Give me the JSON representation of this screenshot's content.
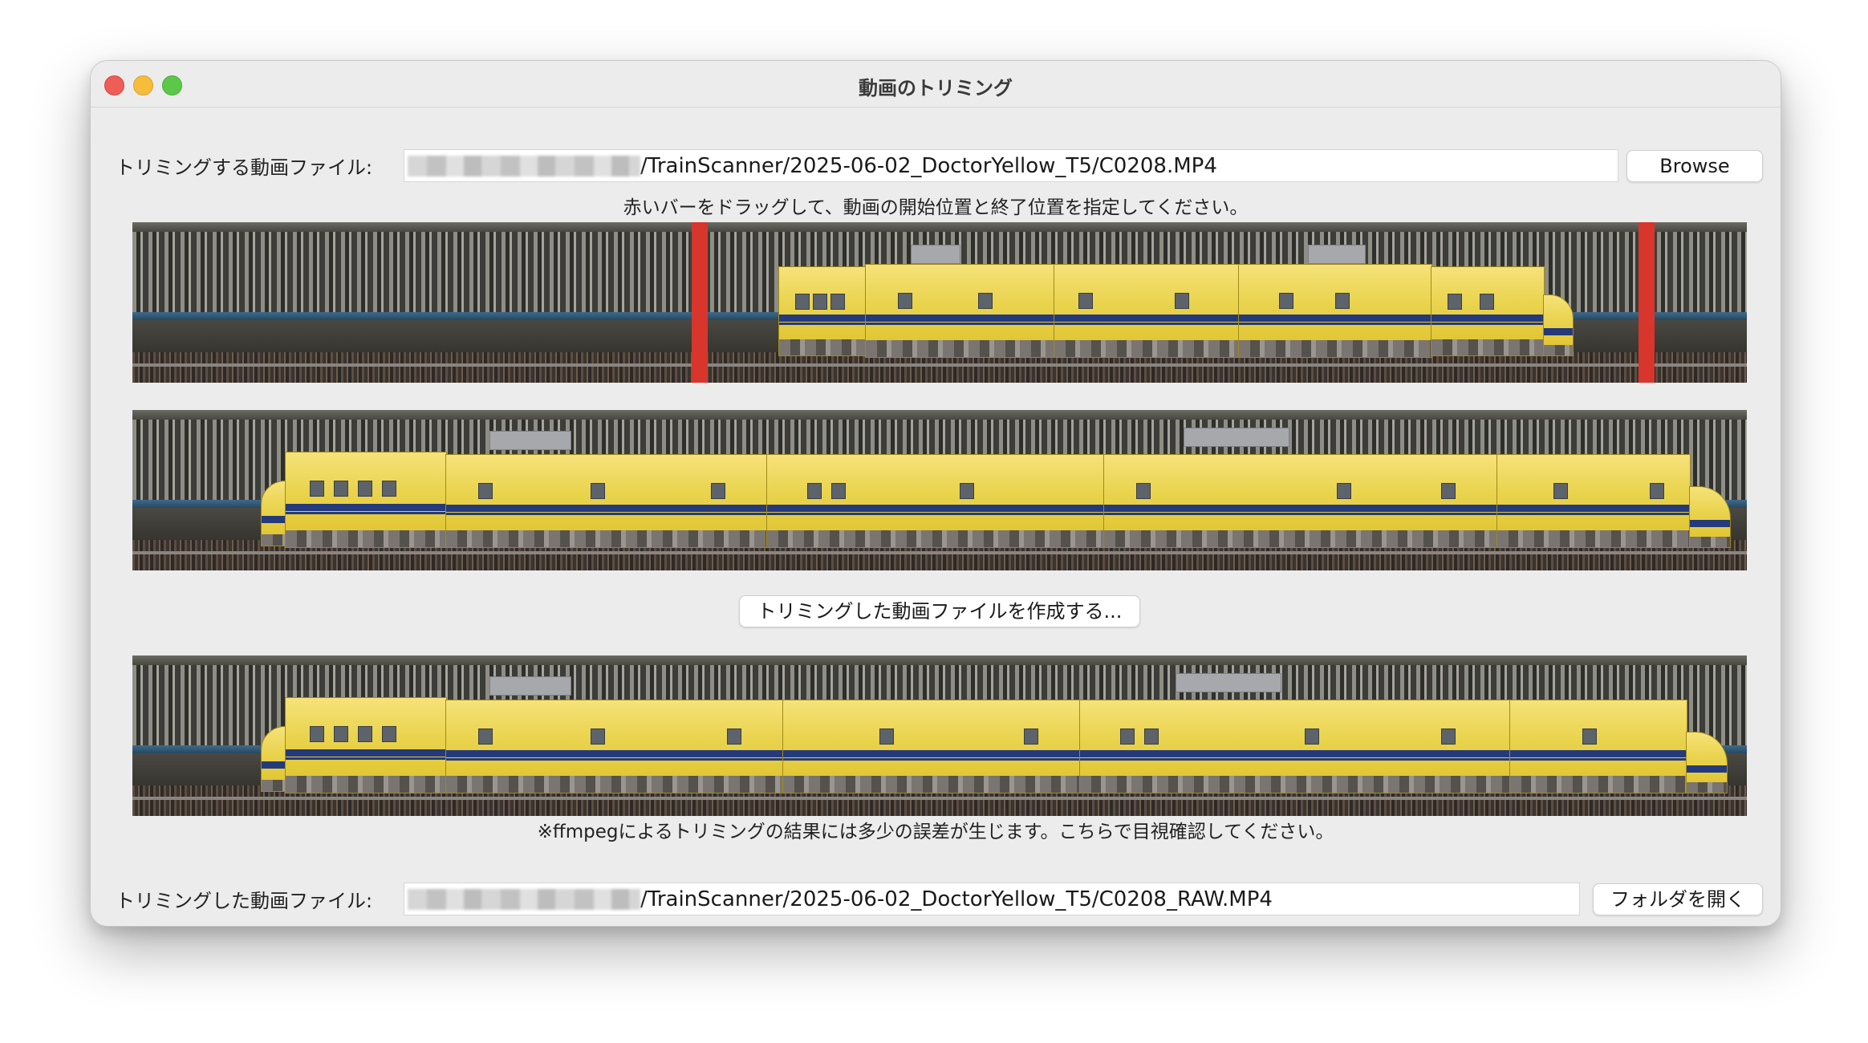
{
  "window": {
    "title": "動画のトリミング"
  },
  "input": {
    "label": "トリミングする動画ファイル:",
    "path": "/TrainScanner/2025-06-02_DoctorYellow_T5/C0208.MP4",
    "browse_label": "Browse"
  },
  "instruction": "赤いバーをドラッグして、動画の開始位置と終了位置を指定してください。",
  "create_button_label": "トリミングした動画ファイルを作成する...",
  "note": "※ffmpegによるトリミングの結果には多少の誤差が生じます。こちらで目視確認してください。",
  "output": {
    "label": "トリミングした動画ファイル:",
    "path": "/TrainScanner/2025-06-02_DoctorYellow_T5/C0208_RAW.MP4",
    "open_folder_label": "フォルダを開く"
  },
  "colors": {
    "trim_bar": "#d8352c",
    "train_body": "#ead44f",
    "train_stripe": "#253a7a"
  }
}
